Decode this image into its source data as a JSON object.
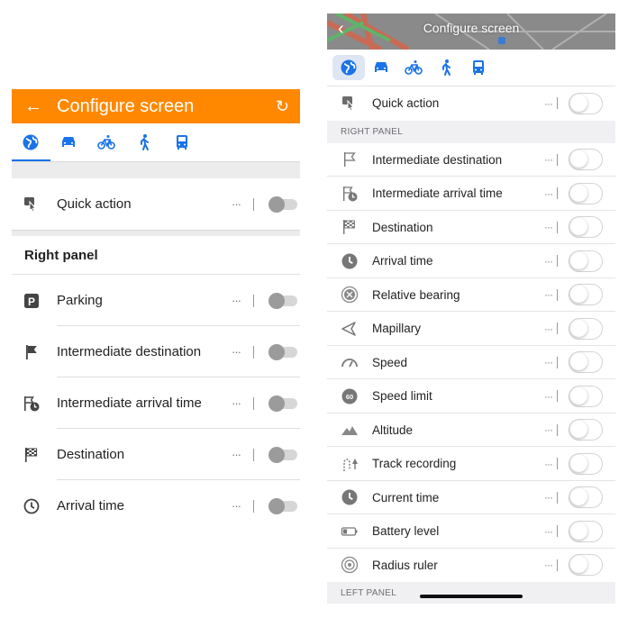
{
  "android": {
    "title": "Configure screen",
    "back_icon": "arrow-left-icon",
    "reset_icon": "reset-icon",
    "tabs": [
      "globe-icon",
      "car-icon",
      "bicycle-icon",
      "pedestrian-icon",
      "bus-icon"
    ],
    "quick_action": {
      "label": "Quick action",
      "more": "···"
    },
    "section_header": "Right panel",
    "items": [
      {
        "label": "Parking",
        "icon": "parking-icon",
        "more": "···"
      },
      {
        "label": "Intermediate destination",
        "icon": "flag-icon",
        "more": "···"
      },
      {
        "label": "Intermediate arrival time",
        "icon": "flag-clock-icon",
        "more": "···"
      },
      {
        "label": "Destination",
        "icon": "checkered-flag-icon",
        "more": "···"
      },
      {
        "label": "Arrival time",
        "icon": "clock-icon",
        "more": "···"
      }
    ],
    "accent_color": "#ff8800"
  },
  "ios": {
    "title": "Configure screen",
    "back_icon": "chevron-left-icon",
    "tabs": [
      "globe-icon",
      "car-icon",
      "bicycle-icon",
      "pedestrian-icon",
      "bus-icon"
    ],
    "quick_action": {
      "label": "Quick action",
      "more": "···"
    },
    "right_panel_header": "RIGHT PANEL",
    "items": [
      {
        "label": "Intermediate destination",
        "icon": "flag-icon",
        "more": "···"
      },
      {
        "label": "Intermediate arrival time",
        "icon": "flag-clock-icon",
        "more": "···"
      },
      {
        "label": "Destination",
        "icon": "checkered-flag-icon",
        "more": "···"
      },
      {
        "label": "Arrival time",
        "icon": "clock-icon",
        "more": "···"
      },
      {
        "label": "Relative bearing",
        "icon": "bearing-icon",
        "more": "···"
      },
      {
        "label": "Mapillary",
        "icon": "mapillary-icon",
        "more": "···"
      },
      {
        "label": "Speed",
        "icon": "speedometer-icon",
        "more": "···"
      },
      {
        "label": "Speed limit",
        "icon": "speed-limit-icon",
        "more": "···"
      },
      {
        "label": "Altitude",
        "icon": "mountain-icon",
        "more": "···"
      },
      {
        "label": "Track recording",
        "icon": "track-recording-icon",
        "more": "···"
      },
      {
        "label": "Current time",
        "icon": "clock-icon",
        "more": "···"
      },
      {
        "label": "Battery level",
        "icon": "battery-icon",
        "more": "···"
      },
      {
        "label": "Radius ruler",
        "icon": "radius-ruler-icon",
        "more": "···"
      }
    ],
    "left_panel_header": "LEFT PANEL",
    "accent_color": "#1a73e8"
  }
}
